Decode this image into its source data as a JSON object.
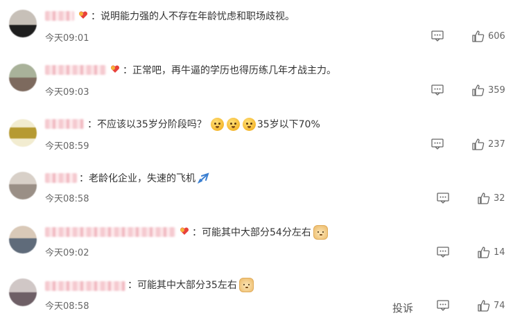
{
  "colors": {
    "text": "#333333",
    "meta": "#666666",
    "badge_red": "#e8413b"
  },
  "comments": [
    {
      "sep": "：",
      "text": "说明能力强的人不存在年龄忧虑和职场歧视。",
      "time": "今天09:01",
      "likes": "606",
      "badge": "heart-badge-icon",
      "avatar": [
        "#c7c0b8",
        "#1e1e1e"
      ]
    },
    {
      "sep": "：",
      "text": "正常吧，再牛逼的学历也得历练几年才战主力。",
      "time": "今天09:03",
      "likes": "359",
      "badge": "heart-badge-icon",
      "avatar": [
        "#a9b29a",
        "#7d6a5e"
      ]
    },
    {
      "sep": "：",
      "text": "不应该以35岁分阶段吗？",
      "suffix": "35岁以下70%",
      "time": "今天08:59",
      "likes": "237",
      "avatar": [
        "#e9dfb0",
        "#b69a32"
      ]
    },
    {
      "sep": "：",
      "text": "老龄化企业，失速的飞机",
      "time": "今天08:58",
      "likes": "32",
      "avatar": [
        "#d8d0c8",
        "#9a8f86"
      ]
    },
    {
      "sep": "：",
      "text": "可能其中大部分54分左右",
      "time": "今天09:02",
      "likes": "14",
      "badge": "heart-badge-icon",
      "avatar": [
        "#d9c9b8",
        "#5f6b7a"
      ]
    },
    {
      "sep": "：",
      "text": "可能其中大部分35左右",
      "time": "今天08:58",
      "likes": "74",
      "avatar": [
        "#d0c7c6",
        "#6e5f66"
      ]
    }
  ],
  "report_label": "投诉"
}
